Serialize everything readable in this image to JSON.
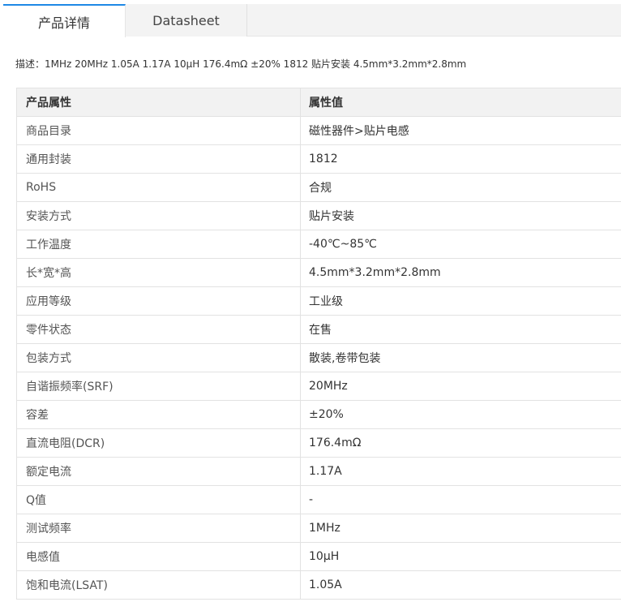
{
  "tabs": [
    {
      "label": "产品详情",
      "active": true
    },
    {
      "label": "Datasheet",
      "active": false
    }
  ],
  "description": "描述：1MHz 20MHz 1.05A 1.17A 10μH 176.4mΩ ±20% 1812 贴片安装 4.5mm*3.2mm*2.8mm",
  "table": {
    "headers": {
      "attribute": "产品属性",
      "value": "属性值"
    },
    "rows": [
      {
        "attribute": "商品目录",
        "value": "磁性器件>贴片电感"
      },
      {
        "attribute": "通用封装",
        "value": "1812"
      },
      {
        "attribute": "RoHS",
        "value": "合规"
      },
      {
        "attribute": "安装方式",
        "value": "贴片安装"
      },
      {
        "attribute": "工作温度",
        "value": "-40℃~85℃"
      },
      {
        "attribute": "长*宽*高",
        "value": "4.5mm*3.2mm*2.8mm"
      },
      {
        "attribute": "应用等级",
        "value": "工业级"
      },
      {
        "attribute": "零件状态",
        "value": "在售"
      },
      {
        "attribute": "包装方式",
        "value": "散装,卷带包装"
      },
      {
        "attribute": "自谐振频率(SRF)",
        "value": "20MHz"
      },
      {
        "attribute": "容差",
        "value": "±20%"
      },
      {
        "attribute": "直流电阻(DCR)",
        "value": "176.4mΩ"
      },
      {
        "attribute": "额定电流",
        "value": "1.17A"
      },
      {
        "attribute": "Q值",
        "value": "-"
      },
      {
        "attribute": "测试频率",
        "value": "1MHz"
      },
      {
        "attribute": "电感值",
        "value": "10μH"
      },
      {
        "attribute": "饱和电流(LSAT)",
        "value": "1.05A"
      }
    ]
  }
}
